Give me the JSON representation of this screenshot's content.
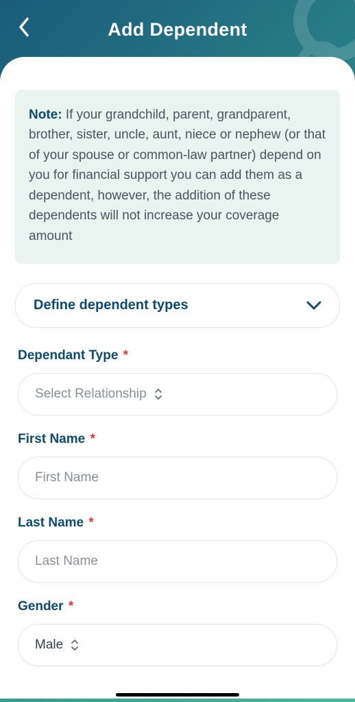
{
  "header": {
    "title": "Add Dependent"
  },
  "note": {
    "label": "Note:",
    "text": " If your grandchild, parent, grandparent, brother, sister, uncle, aunt, niece or nephew (or that of your spouse or common-law partner) depend on you for financial support you can add them as a dependent, however, the addition of these dependents will not increase your coverage amount"
  },
  "expand": {
    "label": "Define dependent types"
  },
  "fields": {
    "dependantType": {
      "label": "Dependant Type",
      "required": "*",
      "placeholder": "Select Relationship"
    },
    "firstName": {
      "label": "First Name",
      "required": "*",
      "placeholder": "First Name"
    },
    "lastName": {
      "label": "Last Name",
      "required": "*",
      "placeholder": "Last Name"
    },
    "gender": {
      "label": "Gender",
      "required": "*",
      "value": "Male"
    }
  }
}
